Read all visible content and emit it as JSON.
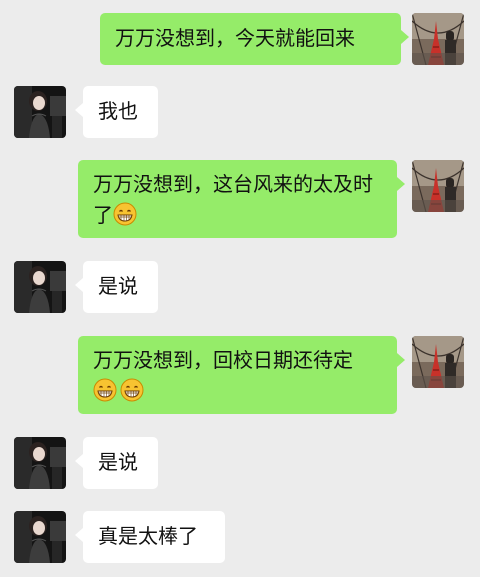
{
  "messages": [
    {
      "side": "right",
      "text": "万万没想到，今天就能回来",
      "emoji": []
    },
    {
      "side": "left",
      "text": "我也",
      "emoji": []
    },
    {
      "side": "right",
      "text": "万万没想到，这台风来的太及时了",
      "emoji": [
        "grinning-face-emoji"
      ]
    },
    {
      "side": "left",
      "text": "是说",
      "emoji": []
    },
    {
      "side": "right",
      "text": "万万没想到，回校日期还待定",
      "emoji": [
        "grinning-face-emoji",
        "grinning-face-emoji"
      ]
    },
    {
      "side": "left",
      "text": "是说",
      "emoji": []
    },
    {
      "side": "left",
      "text": "真是太棒了",
      "emoji": []
    }
  ],
  "colors": {
    "background": "#ececec",
    "my_bubble": "#95ec69",
    "other_bubble": "#ffffff"
  },
  "icons": {
    "my_avatar": "eiffel-tower-avatar",
    "other_avatar": "girl-portrait-avatar"
  }
}
